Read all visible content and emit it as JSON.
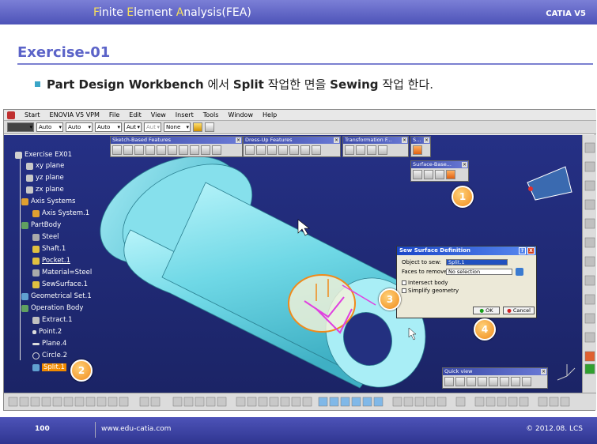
{
  "header": {
    "title_parts": [
      {
        "hl": "F",
        "rest": "inite "
      },
      {
        "hl": "E",
        "rest": "lement "
      },
      {
        "hl": "A",
        "rest": "nalysis(FEA)"
      }
    ],
    "brand": "CATIA V5"
  },
  "slide": {
    "title": "Exercise-01",
    "bullet": {
      "b1": "Part Design Workbench",
      "t1": " 에서 ",
      "b2": "Split",
      "t2": " 작업한 면을 ",
      "b3": "Sewing",
      "t3": " 작업 한다."
    }
  },
  "menubar": [
    "Start",
    "ENOVIA V5 VPM",
    "File",
    "Edit",
    "View",
    "Insert",
    "Tools",
    "Window",
    "Help"
  ],
  "options": {
    "c1": "Auto",
    "c2": "Auto",
    "c3": "Auto",
    "c4": "Aut",
    "c5": "Aut",
    "c6": "None"
  },
  "tree": {
    "root": "Exercise EX01",
    "xy": "xy plane",
    "yz": "yz plane",
    "zx": "zx plane",
    "axis_systems": "Axis Systems",
    "axis_system1": "Axis System.1",
    "partbody": "PartBody",
    "steel": "Steel",
    "shaft": "Shaft.1",
    "pocket": "Pocket.1",
    "material": "Material=Steel",
    "sewsurface": "SewSurface.1",
    "geoset": "Geometrical Set.1",
    "opbody": "Operation Body",
    "extract": "Extract.1",
    "point": "Point.2",
    "plane": "Plane.4",
    "circle": "Circle.2",
    "split": "Split.1"
  },
  "toolbars": {
    "sketch": "Sketch-Based Features",
    "dressup": "Dress-Up Features",
    "transform": "Transformation F...",
    "s": "S...",
    "surface": "Surface-Base...",
    "quick": "Quick view"
  },
  "dialog": {
    "title": "Sew Surface Definition",
    "object_label": "Object to sew:",
    "object_value": "Split.1",
    "faces_label": "Faces to remove:",
    "faces_value": "No selection",
    "intersect": "Intersect body",
    "simplify": "Simplify geometry",
    "ok": "OK",
    "cancel": "Cancel",
    "help_btn": "?",
    "close_btn": "X"
  },
  "callouts": {
    "c1": "1",
    "c2": "2",
    "c3": "3",
    "c4": "4"
  },
  "footer": {
    "page": "100",
    "url": "www.edu-catia.com",
    "copyright": "© 2012.08. LCS"
  },
  "colors": {
    "header": "#4d53b8",
    "highlight": "#f7e05a",
    "viewport": "#253085",
    "part": "#7fe0ec",
    "callout": "#f08a1a"
  }
}
